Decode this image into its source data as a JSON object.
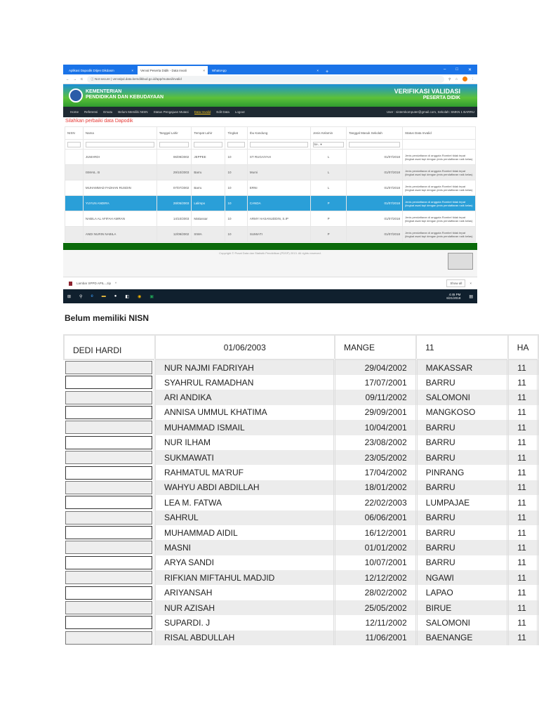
{
  "browser": {
    "tabs": [
      "Aplikasi Dapodik Ditjen Dikdasm",
      "Verval Peserta Didik - Data Invali",
      "WhatsApp"
    ],
    "security": "Not secure",
    "url": "vervalpd.data.kemdikbud.go.id/app/mutasi/invalid"
  },
  "site": {
    "ministry_line1": "KEMENTERIAN",
    "ministry_line2": "PENDIDIKAN DAN KEBUDAYAAN",
    "app_line1": "VERIFIKASI VALIDASI",
    "app_line2": "PESERTA DIDIK",
    "nav": [
      "Home",
      "Referensi",
      "Emutu",
      "Belum Memiliki NISN",
      "Status Pengajuan Mutasi",
      "Data Invalid",
      "Edit Data",
      "Logout"
    ],
    "active_nav": "Data Invalid",
    "user": "User : sistemkomputer@gmail.com, Sekolah: SMKN 1 BARRU",
    "message": "Silahkan perbaiki data Dapodik",
    "columns": [
      "NISN",
      "Nama",
      "Tanggal Lahir",
      "Tempat Lahir",
      "Tingkat",
      "Ibu Kandung",
      "Jenis Kelamin",
      "Tanggal Masuk Sekolah",
      "Status Data Invalid"
    ],
    "filter_select": "Se..",
    "rows": [
      {
        "nisn": "",
        "nama": "JUMARDI",
        "tgl": "06/09/2002",
        "tempat": "JEPPEE",
        "tingkat": "10",
        "ibu": "ST RUGAIYAH",
        "jk": "L",
        "masuk": "01/07/2018",
        "status": "Jenis pendaftaran di anggota Rombel tidak tepat (tingkat awal tapi dengan jenis pendaftaran naik kelas)"
      },
      {
        "nisn": "",
        "nama": "ISMAIL. B",
        "tgl": "29/10/2003",
        "tempat": "Barru",
        "tingkat": "10",
        "ibu": "Murni",
        "jk": "L",
        "masuk": "01/07/2018",
        "status": "Jenis pendaftaran di anggota Rombel tidak tepat (tingkat awal tapi dengan jenis pendaftaran naik kelas)"
      },
      {
        "nisn": "",
        "nama": "MUHAMMAD FADHAN RUSDIN",
        "tgl": "07/07/2002",
        "tempat": "Barru",
        "tingkat": "10",
        "ibu": "ERNI",
        "jk": "L",
        "masuk": "01/07/2018",
        "status": "Jenis pendaftaran di anggota Rombel tidak tepat (tingkat awal tapi dengan jenis pendaftaran naik kelas)"
      },
      {
        "nisn": "",
        "nama": "YUYUN ANDIRA",
        "tgl": "28/05/2003",
        "tempat": "Lalimpo",
        "tingkat": "10",
        "ibu": "CANDA",
        "jk": "P",
        "masuk": "01/07/2018",
        "status": "Jenis pendaftaran di anggota Rombel tidak tepat (tingkat awal tapi dengan jenis pendaftaran naik kelas)"
      },
      {
        "nisn": "",
        "nama": "NABILA AL AFIFAH AMRAN",
        "tgl": "14/10/2003",
        "tempat": "Makassar",
        "tingkat": "10",
        "ibu": "ARMY HASANUDDIN, S.IP",
        "jk": "P",
        "masuk": "01/07/2018",
        "status": "Jenis pendaftaran di anggota Rombel tidak tepat (tingkat awal tapi dengan jenis pendaftaran naik kelas)"
      },
      {
        "nisn": "",
        "nama": "ANDI NURIN NABILA",
        "tgl": "12/09/2002",
        "tempat": "SIWA",
        "tingkat": "10",
        "ibu": "SUMIATI",
        "jk": "P",
        "masuk": "01/07/2018",
        "status": "Jenis pendaftaran di anggota Rombel tidak tepat (tingkat awal tapi dengan jenis pendaftaran naik kelas)"
      }
    ],
    "selected_row": "YUYUN ANDIRA",
    "copyright": "Copyright © Pusat Data dan Statistik Pendidikan (PDSP) 2013. All rights reserved."
  },
  "download": {
    "file": "Lambar SPPD APIL...zip",
    "show_all": "Show all"
  },
  "taskbar": {
    "time": "4:45 PM",
    "date": "6/21/2018"
  },
  "doc": {
    "heading": "Belum memiliki NISN",
    "header_row": {
      "nama": "DEDI HARDI",
      "tgl": "01/06/2003",
      "tempat": "MANGE",
      "tingkat": "11",
      "extra": "HA"
    },
    "rows": [
      [
        "NUR NAJMI FADRIYAH",
        "29/04/2002",
        "MAKASSAR",
        "11"
      ],
      [
        "SYAHRUL RAMADHAN",
        "17/07/2001",
        "BARRU",
        "11"
      ],
      [
        "ARI ANDIKA",
        "09/11/2002",
        "SALOMONI",
        "11"
      ],
      [
        "ANNISA UMMUL KHATIMA",
        "29/09/2001",
        "MANGKOSO",
        "11"
      ],
      [
        "MUHAMMAD ISMAIL",
        "10/04/2001",
        "BARRU",
        "11"
      ],
      [
        "NUR ILHAM",
        "23/08/2002",
        "BARRU",
        "11"
      ],
      [
        "SUKMAWATI",
        "23/05/2002",
        "BARRU",
        "11"
      ],
      [
        "RAHMATUL MA'RUF",
        "17/04/2002",
        "PINRANG",
        "11"
      ],
      [
        "WAHYU ABDI ABDILLAH",
        "18/01/2002",
        "BARRU",
        "11"
      ],
      [
        "LEA M. FATWA",
        "22/02/2003",
        "LUMPAJAE",
        "11"
      ],
      [
        "SAHRUL",
        "06/06/2001",
        "BARRU",
        "11"
      ],
      [
        "MUHAMMAD AIDIL",
        "16/12/2001",
        "BARRU",
        "11"
      ],
      [
        "MASNI",
        "01/01/2002",
        "BARRU",
        "11"
      ],
      [
        "ARYA SANDI",
        "10/07/2001",
        "BARRU",
        "11"
      ],
      [
        "RIFKIAN MIFTAHUL MADJID",
        "12/12/2002",
        "NGAWI",
        "11"
      ],
      [
        "ARIYANSAH",
        "28/02/2002",
        "LAPAO",
        "11"
      ],
      [
        "NUR AZISAH",
        "25/05/2002",
        "BIRUE",
        "11"
      ],
      [
        "SUPARDI. J",
        "12/11/2002",
        "SALOMONI",
        "11"
      ],
      [
        "RISAL ABDULLAH",
        "11/06/2001",
        "BAENANGE",
        "11"
      ]
    ]
  }
}
